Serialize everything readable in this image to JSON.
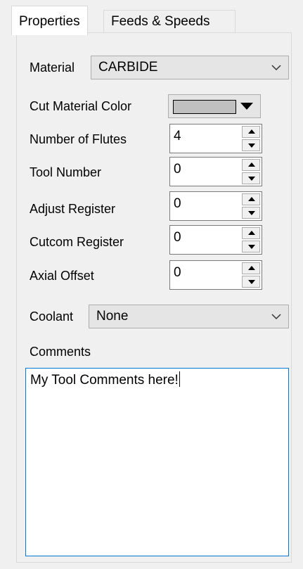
{
  "tabs": [
    {
      "label": "Properties",
      "active": true
    },
    {
      "label": "Feeds & Speeds",
      "active": false
    }
  ],
  "material": {
    "label": "Material",
    "value": "CARBIDE"
  },
  "cut_material_color": {
    "label": "Cut Material Color",
    "swatch": "#c0c0c0"
  },
  "fields": {
    "number_of_flutes": {
      "label": "Number of Flutes",
      "value": "4"
    },
    "tool_number": {
      "label": "Tool Number",
      "value": "0"
    },
    "adjust_register": {
      "label": "Adjust Register",
      "value": "0"
    },
    "cutcom_register": {
      "label": "Cutcom Register",
      "value": "0"
    },
    "axial_offset": {
      "label": "Axial Offset",
      "value": "0"
    }
  },
  "coolant": {
    "label": "Coolant",
    "value": "None"
  },
  "comments": {
    "label": "Comments",
    "value": "My Tool Comments here!"
  },
  "colors": {
    "focus_border": "#0078d7",
    "background": "#f0f0f0"
  }
}
